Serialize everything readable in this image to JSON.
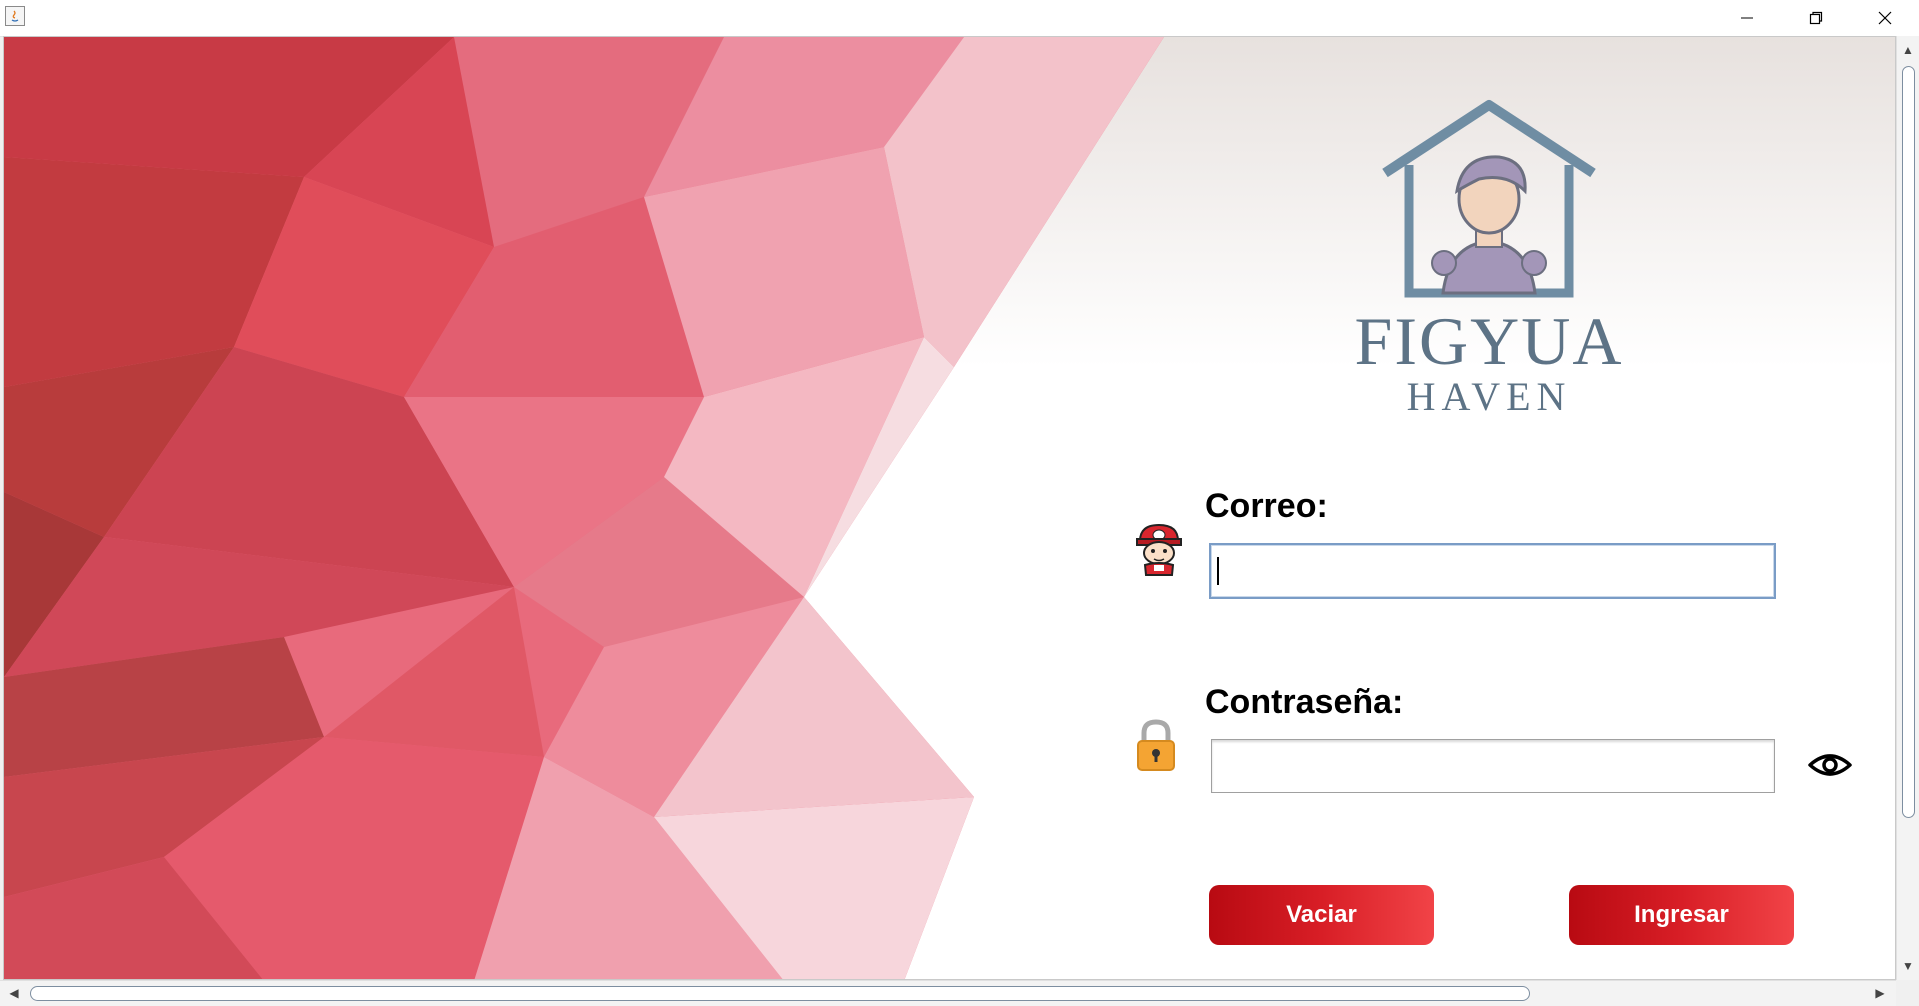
{
  "window": {
    "title": "",
    "controls": [
      "minimize",
      "maximize",
      "close"
    ]
  },
  "brand": {
    "name_line1": "FIGYUA",
    "name_line2": "HAVEN",
    "logo_icon": "house-character-icon",
    "color": "#5d7386"
  },
  "form": {
    "email_label": "Correo:",
    "email_value": "",
    "email_icon": "character-avatar-icon",
    "password_label": "Contraseña:",
    "password_value": "",
    "password_icon": "lock-icon",
    "toggle_visibility_icon": "eye-icon"
  },
  "buttons": {
    "clear_label": "Vaciar",
    "login_label": "Ingresar",
    "color": "#d81e26"
  },
  "background": {
    "style": "red low-poly triangles",
    "accent": "#e04a5a"
  }
}
